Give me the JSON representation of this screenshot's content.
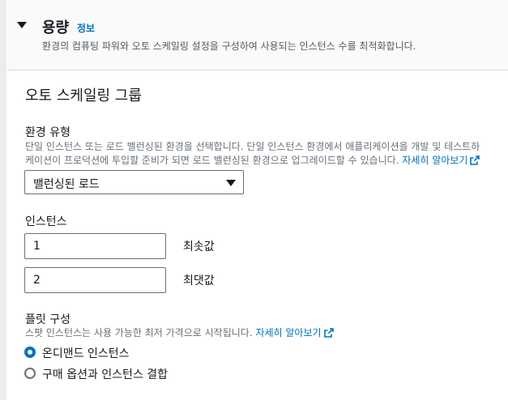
{
  "section": {
    "title": "용량",
    "info_link": "정보",
    "description": "환경의 컴퓨팅 파워와 오토 스케일링 설정을 구성하여 사용되는 인스턴스 수를 최적화합니다."
  },
  "asg": {
    "title": "오토 스케일링 그룹",
    "env_type": {
      "label": "환경 유형",
      "desc_line1": "단일 인스턴스 또는 로드 밸런싱된 환경을 선택합니다. 단일 인스턴스 환경에서 애플리케이션을 개발 및 테스트하",
      "desc_line2": "케이션이 프로덕션에 투입할 준비가 되면 로드 밸런싱된 환경으로 업그레이드할 수 있습니다.",
      "learn_more": "자세히 알아보기",
      "selected": "밸런싱된 로드"
    },
    "instances": {
      "label": "인스턴스",
      "min_value": "1",
      "min_label": "최솟값",
      "max_value": "2",
      "max_label": "최댓값"
    },
    "fleet": {
      "label": "플릿 구성",
      "desc": "스팟 인스턴스는 사용 가능한 최저 가격으로 시작됩니다.",
      "learn_more": "자세히 알아보기",
      "options": [
        {
          "label": "온디맨드 인스턴스",
          "selected": true
        },
        {
          "label": "구매 옵션과 인스턴스 결합",
          "selected": false
        }
      ]
    }
  },
  "colors": {
    "link": "#0073bb",
    "radio_selected": "#0073bb",
    "text": "#16191f",
    "muted": "#687078"
  },
  "icons": {
    "collapse": "caret-down-icon",
    "external": "external-link-icon",
    "dropdown": "dropdown-arrow-icon"
  }
}
